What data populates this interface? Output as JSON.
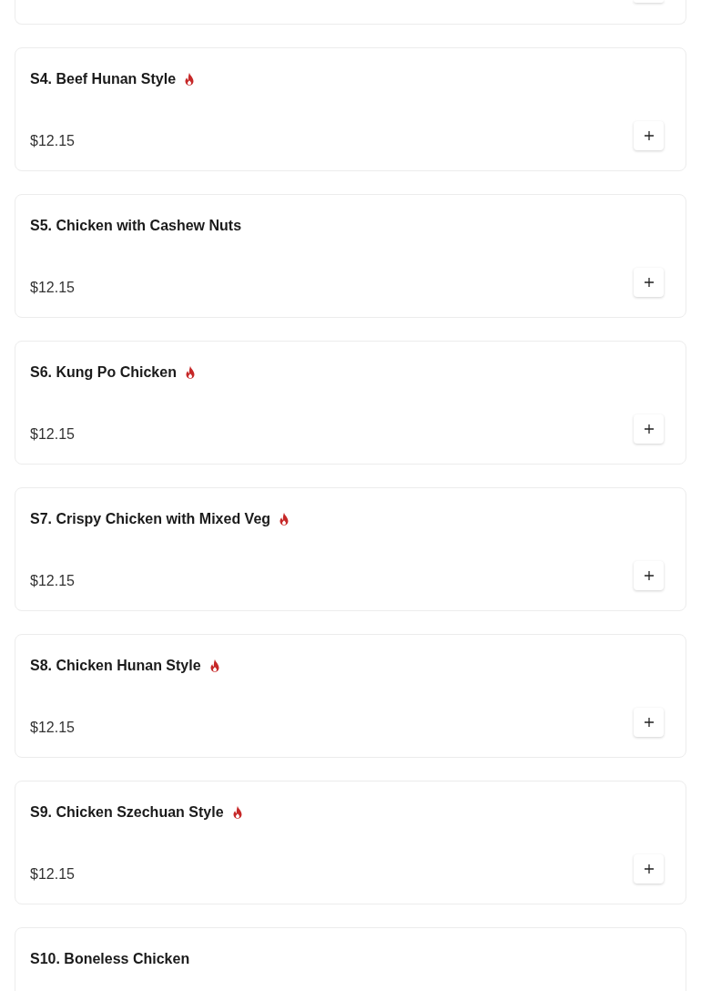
{
  "items": [
    {
      "title": "S4. Beef Hunan Style",
      "spicy": true,
      "price": "$12.15"
    },
    {
      "title": "S5. Chicken with Cashew Nuts",
      "spicy": false,
      "price": "$12.15"
    },
    {
      "title": "S6. Kung Po Chicken",
      "spicy": true,
      "price": "$12.15"
    },
    {
      "title": "S7. Crispy Chicken with Mixed Veg",
      "spicy": true,
      "price": "$12.15"
    },
    {
      "title": "S8. Chicken Hunan Style",
      "spicy": true,
      "price": "$12.15"
    },
    {
      "title": "S9. Chicken Szechuan Style",
      "spicy": true,
      "price": "$12.15"
    },
    {
      "title": "S10. Boneless Chicken",
      "spicy": false
    }
  ]
}
